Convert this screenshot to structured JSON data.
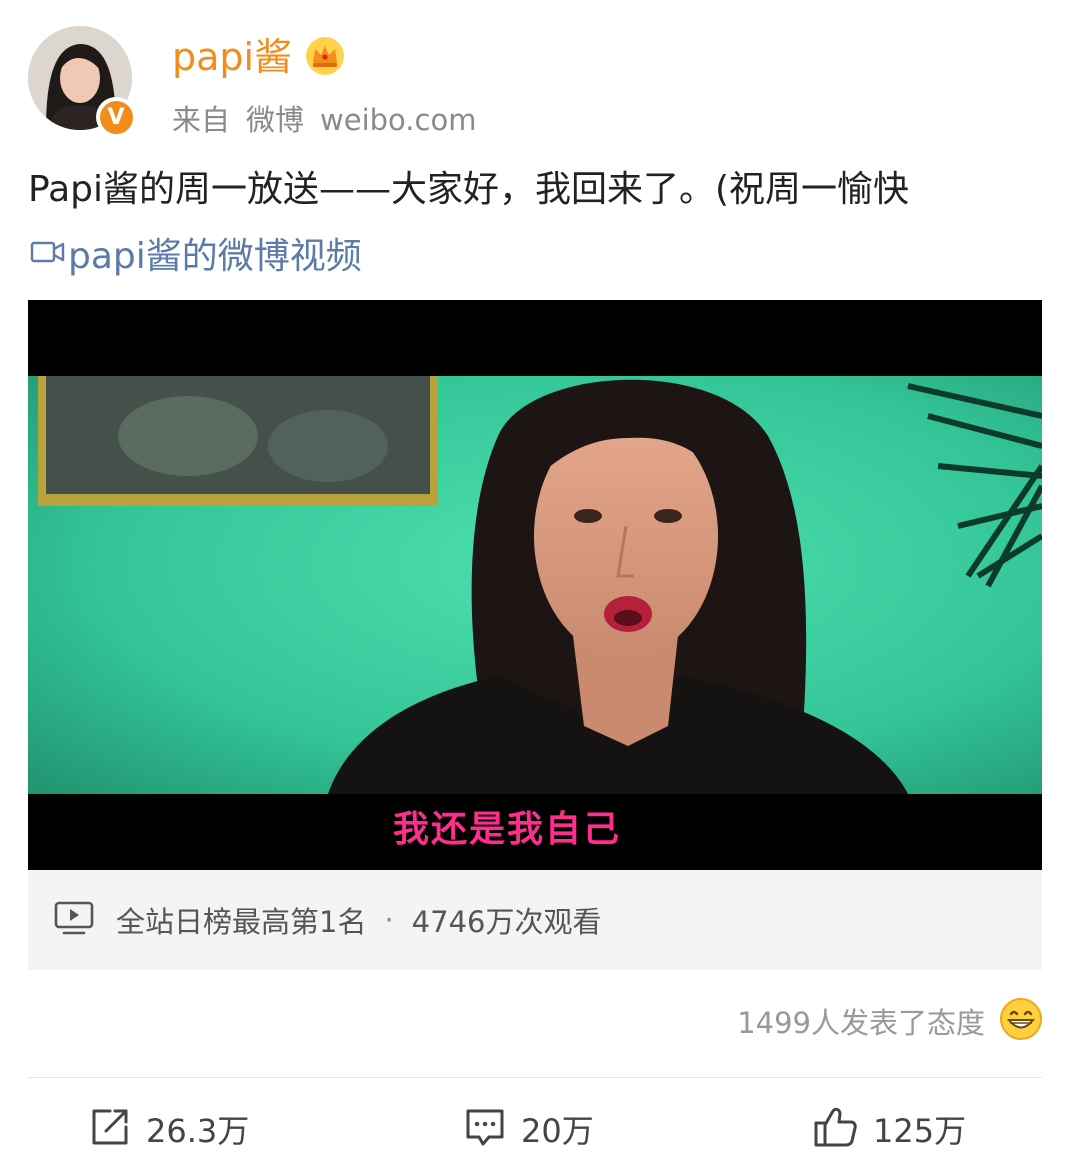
{
  "header": {
    "username": "papi酱",
    "source_prefix": "来自",
    "source_app": "微博",
    "source_domain": "weibo.com",
    "verified_label": "V"
  },
  "post": {
    "text": "Papi酱的周一放送——大家好，我回来了。(祝周一愉快",
    "video_link": "papi酱的微博视频"
  },
  "video": {
    "subtitle": "我还是我自己",
    "rank_text": "全站日榜最高第1名",
    "separator": "·",
    "views_text": "4746万次观看"
  },
  "attitudes": {
    "text": "1499人发表了态度",
    "emoji": "grinning-emoji"
  },
  "actions": {
    "repost_count": "26.3万",
    "comment_count": "20万",
    "like_count": "125万"
  },
  "colors": {
    "accent_orange": "#f28d1b",
    "link_blue": "#5b7ca8",
    "subtitle_pink": "#ff2d8e",
    "video_background_green": "#35c99a"
  }
}
